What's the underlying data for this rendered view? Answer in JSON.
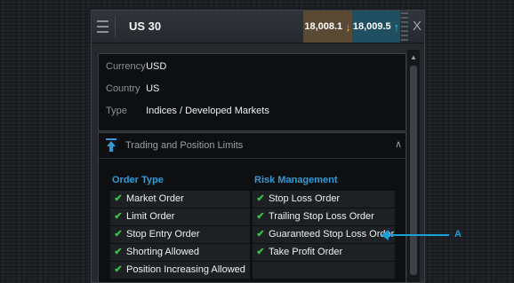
{
  "header": {
    "symbol": "US 30",
    "sell_price": "18,008.1",
    "buy_price": "18,009.5",
    "close_label": "X"
  },
  "info": {
    "currency_label": "Currency",
    "currency_value": "USD",
    "country_label": "Country",
    "country_value": "US",
    "type_label": "Type",
    "type_value": "Indices / Developed Markets"
  },
  "limits": {
    "title": "Trading and Position Limits",
    "order_type_title": "Order Type",
    "risk_title": "Risk Management",
    "order_types": [
      "Market Order",
      "Limit Order",
      "Stop Entry Order",
      "Shorting Allowed",
      "Position Increasing Allowed"
    ],
    "risk_items": [
      "Stop Loss Order",
      "Trailing Stop Loss Order",
      "Guaranteed Stop Loss Order",
      "Take Profit Order"
    ]
  },
  "callout": {
    "label": "A"
  },
  "icons": {
    "menu": "hamburger-icon",
    "sell_arrow": "arrow-down-icon",
    "buy_arrow": "arrow-up-icon",
    "close": "close-icon",
    "section": "upload-icon",
    "collapse": "chevron-up-icon",
    "check": "check-icon"
  },
  "colors": {
    "sell_bg": "#5b4a33",
    "buy_bg": "#1f4f61",
    "accent": "#2d9bd6",
    "check": "#3fc04a",
    "callout": "#1aa0d8"
  }
}
